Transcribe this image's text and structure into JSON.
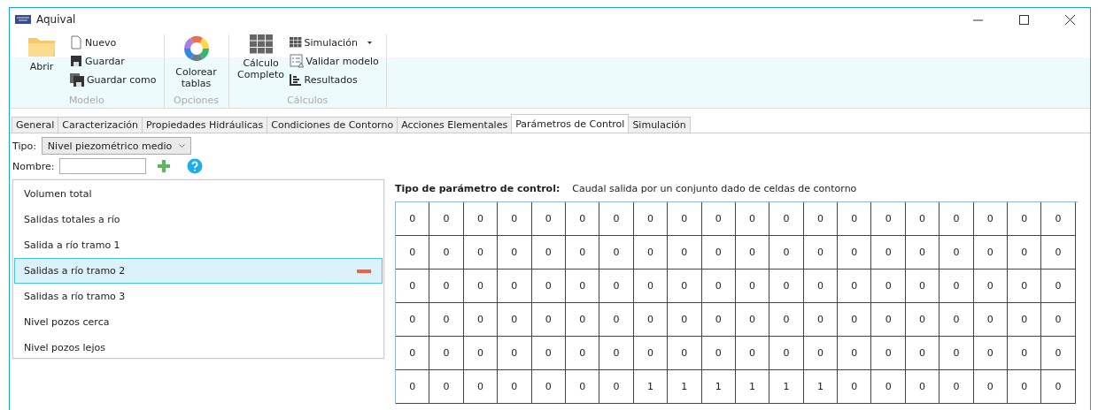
{
  "window": {
    "title": "Aquival"
  },
  "ribbon": {
    "groups": [
      {
        "label": "Modelo",
        "large": [
          {
            "label": "Abrir"
          }
        ],
        "small": [
          {
            "label": "Nuevo"
          },
          {
            "label": "Guardar"
          },
          {
            "label": "Guardar como"
          }
        ]
      },
      {
        "label": "Opciones",
        "large": [
          {
            "label": "Colorear tablas"
          }
        ]
      },
      {
        "label": "Cálculos",
        "large": [
          {
            "label": "Cálculo Completo"
          }
        ],
        "small": [
          {
            "label": "Simulación",
            "dropdown": true
          },
          {
            "label": "Validar modelo"
          },
          {
            "label": "Resultados"
          }
        ]
      }
    ]
  },
  "tabs": [
    {
      "label": "General",
      "selected": false
    },
    {
      "label": "Caracterización",
      "selected": false
    },
    {
      "label": "Propiedades Hidráulicas",
      "selected": false
    },
    {
      "label": "Condiciones de Contorno",
      "selected": false
    },
    {
      "label": "Acciones Elementales",
      "selected": false
    },
    {
      "label": "Parámetros de Control",
      "selected": true
    },
    {
      "label": "Simulación",
      "selected": false
    }
  ],
  "tipo": {
    "label": "Tipo:",
    "value": "Nivel piezométrico medio"
  },
  "nombre": {
    "label": "Nombre:"
  },
  "parameters": [
    {
      "label": "Volumen total",
      "selected": false
    },
    {
      "label": "Salidas totales a río",
      "selected": false
    },
    {
      "label": "Salida a río tramo 1",
      "selected": false
    },
    {
      "label": "Salidas a río tramo 2",
      "selected": true
    },
    {
      "label": "Salidas a río tramo 3",
      "selected": false
    },
    {
      "label": "Nivel pozos cerca",
      "selected": false
    },
    {
      "label": "Nivel pozos lejos",
      "selected": false
    }
  ],
  "detail": {
    "label": "Tipo de parámetro de control:",
    "value": "Caudal salida por un conjunto dado de celdas de contorno"
  },
  "grid": [
    [
      "0",
      "0",
      "0",
      "0",
      "0",
      "0",
      "0",
      "0",
      "0",
      "0",
      "0",
      "0",
      "0",
      "0",
      "0",
      "0",
      "0",
      "0",
      "0",
      "0"
    ],
    [
      "0",
      "0",
      "0",
      "0",
      "0",
      "0",
      "0",
      "0",
      "0",
      "0",
      "0",
      "0",
      "0",
      "0",
      "0",
      "0",
      "0",
      "0",
      "0",
      "0"
    ],
    [
      "0",
      "0",
      "0",
      "0",
      "0",
      "0",
      "0",
      "0",
      "0",
      "0",
      "0",
      "0",
      "0",
      "0",
      "0",
      "0",
      "0",
      "0",
      "0",
      "0"
    ],
    [
      "0",
      "0",
      "0",
      "0",
      "0",
      "0",
      "0",
      "0",
      "0",
      "0",
      "0",
      "0",
      "0",
      "0",
      "0",
      "0",
      "0",
      "0",
      "0",
      "0"
    ],
    [
      "0",
      "0",
      "0",
      "0",
      "0",
      "0",
      "0",
      "0",
      "0",
      "0",
      "0",
      "0",
      "0",
      "0",
      "0",
      "0",
      "0",
      "0",
      "0",
      "0"
    ],
    [
      "0",
      "0",
      "0",
      "0",
      "0",
      "0",
      "0",
      "1",
      "1",
      "1",
      "1",
      "1",
      "1",
      "0",
      "0",
      "0",
      "0",
      "0",
      "0",
      "0"
    ]
  ]
}
